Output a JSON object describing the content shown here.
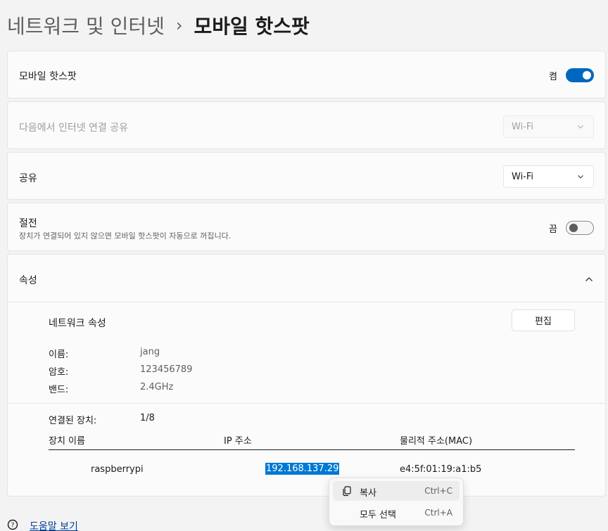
{
  "breadcrumb": {
    "parent": "네트워크 및 인터넷",
    "separator": "›",
    "current": "모바일 핫스팟"
  },
  "hotspot": {
    "label": "모바일 핫스팟",
    "state_text": "켬",
    "enabled": true
  },
  "share_from": {
    "label": "다음에서 인터넷 연결 공유",
    "value": "Wi-Fi",
    "disabled": true
  },
  "share_over": {
    "label": "공유",
    "value": "Wi-Fi"
  },
  "power_saving": {
    "label": "절전",
    "description": "장치가 연결되어 있지 않으면 모바일 핫스팟이 자동으로 꺼집니다.",
    "state_text": "끔",
    "enabled": false
  },
  "properties": {
    "label": "속성",
    "network_properties_label": "네트워크 속성",
    "edit_button": "편집",
    "fields": [
      {
        "key": "이름:",
        "value": "jang"
      },
      {
        "key": "암호:",
        "value": "123456789"
      },
      {
        "key": "밴드:",
        "value": "2.4GHz"
      }
    ],
    "connected_devices_label": "연결된 장치:",
    "connected_devices_value": "1/8",
    "table": {
      "headers": [
        "장치 이름",
        "IP 주소",
        "물리적 주소(MAC)"
      ],
      "rows": [
        {
          "name": "raspberrypi",
          "ip": "192.168.137.29",
          "mac": "e4:5f:01:19:a1:b5"
        }
      ]
    }
  },
  "context_menu": {
    "items": [
      {
        "label": "복사",
        "shortcut": "Ctrl+C",
        "icon": "copy-icon"
      },
      {
        "label": "모두 선택",
        "shortcut": "Ctrl+A",
        "icon": ""
      }
    ]
  },
  "footer": {
    "help_link": "도움말 보기",
    "icon": "help-icon"
  },
  "colors": {
    "accent": "#0067c0",
    "selection": "#0078d4",
    "link": "#003e92",
    "background": "#f3f3f3",
    "card": "#fbfbfb"
  }
}
